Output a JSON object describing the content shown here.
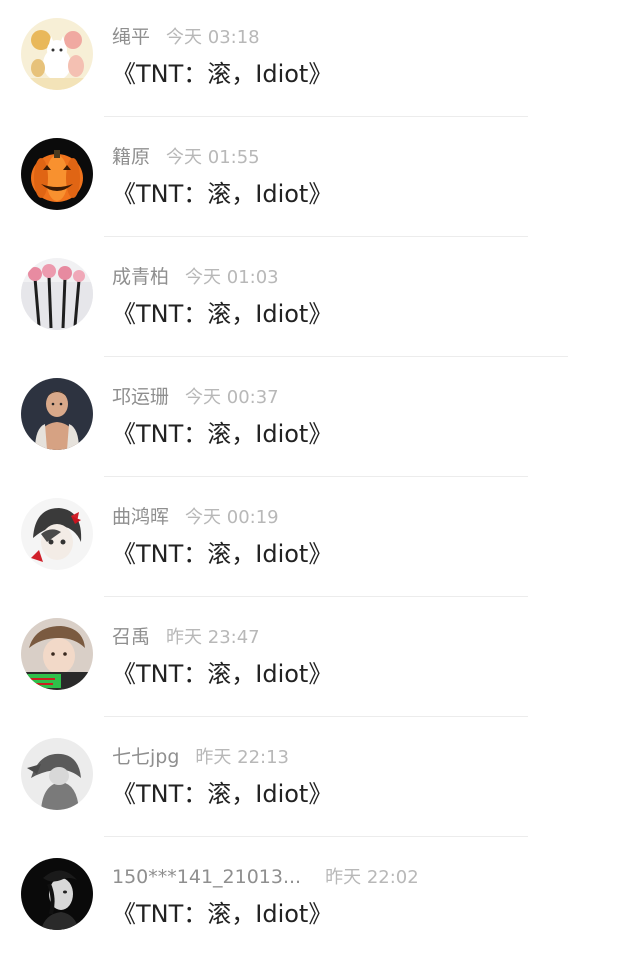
{
  "comments": [
    {
      "name": "绳平",
      "time": "今天 03:18",
      "text": "《TNT：滚，Idiot》",
      "avatar": "cat-avatar"
    },
    {
      "name": "籍原",
      "time": "今天 01:55",
      "text": "《TNT：滚，Idiot》",
      "avatar": "pumpkin-avatar"
    },
    {
      "name": "成青柏",
      "time": "今天 01:03",
      "text": "《TNT：滚，Idiot》",
      "avatar": "roses-avatar"
    },
    {
      "name": "邛运珊",
      "time": "今天 00:37",
      "text": "《TNT：滚，Idiot》",
      "avatar": "man-avatar"
    },
    {
      "name": "曲鸿晖",
      "time": "今天 00:19",
      "text": "《TNT：滚，Idiot》",
      "avatar": "anime-girl-avatar"
    },
    {
      "name": "召禹",
      "time": "昨天 23:47",
      "text": "《TNT：滚，Idiot》",
      "avatar": "boy-photo-avatar"
    },
    {
      "name": "七七jpg",
      "time": "昨天 22:13",
      "text": "《TNT：滚，Idiot》",
      "avatar": "sketch-avatar"
    },
    {
      "name": "150***141_21013...",
      "time": "昨天 22:02",
      "text": "《TNT：滚，Idiot》",
      "avatar": "dark-portrait-avatar"
    }
  ]
}
